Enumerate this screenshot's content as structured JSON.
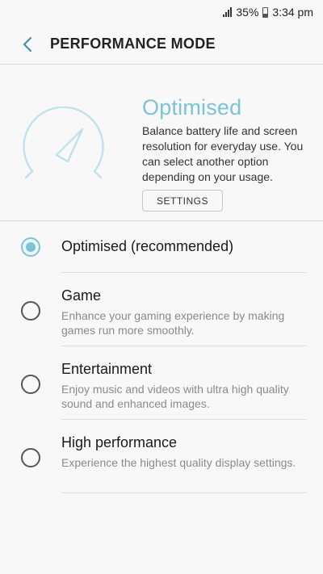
{
  "status_bar": {
    "battery": "35%",
    "time": "3:34 pm"
  },
  "header": {
    "title": "PERFORMANCE MODE"
  },
  "hero": {
    "mode_name": "Optimised",
    "description": "Balance battery life and screen resolution for everyday use. You can select another option depending on your usage.",
    "settings_label": "SETTINGS",
    "accent_color": "#7cc3d6"
  },
  "options": [
    {
      "label": "Optimised (recommended)",
      "description": "",
      "selected": true
    },
    {
      "label": "Game",
      "description": "Enhance your gaming experience by making games run more smoothly.",
      "selected": false
    },
    {
      "label": "Entertainment",
      "description": "Enjoy music and videos with ultra high quality sound and enhanced images.",
      "selected": false
    },
    {
      "label": "High performance",
      "description": "Experience the highest quality display settings.",
      "selected": false
    }
  ]
}
